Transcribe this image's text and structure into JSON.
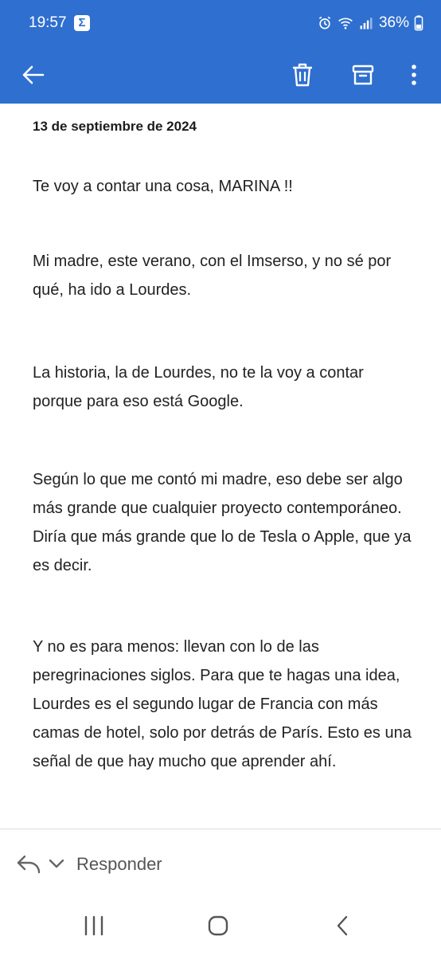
{
  "status_bar": {
    "time": "19:57",
    "app_badge": "Σ",
    "battery": "36%",
    "icons": [
      "alarm-icon",
      "wifi-icon",
      "signal-icon",
      "battery-icon"
    ]
  },
  "app_bar": {
    "background": "#2f6fcf",
    "icons": [
      "back-arrow-icon",
      "trash-icon",
      "archive-icon",
      "more-vertical-icon"
    ]
  },
  "email": {
    "date": "13 de septiembre de 2024",
    "paragraphs": [
      "Te voy a contar una cosa, MARINA !!",
      "Mi madre, este verano, con el Imserso, y no sé por qué, ha ido a Lourdes.",
      "La historia, la de Lourdes, no te la voy a contar porque para eso está Google.",
      "Según lo que me contó mi madre, eso debe ser algo más grande que cualquier proyecto contemporáneo. Diría que más grande que lo de Tesla o Apple, que ya es decir.",
      "Y no es para menos: llevan con lo de las peregrinaciones siglos. Para que te hagas una idea, Lourdes es el segundo lugar de Francia con más camas de hotel, solo por detrás de París. Esto es una señal de que hay mucho que aprender ahí."
    ]
  },
  "reply_bar": {
    "label": "Responder",
    "icons": [
      "reply-icon",
      "chevron-down-icon"
    ]
  },
  "nav_bar": {
    "icons": [
      "recents-icon",
      "home-icon",
      "nav-back-icon"
    ]
  }
}
